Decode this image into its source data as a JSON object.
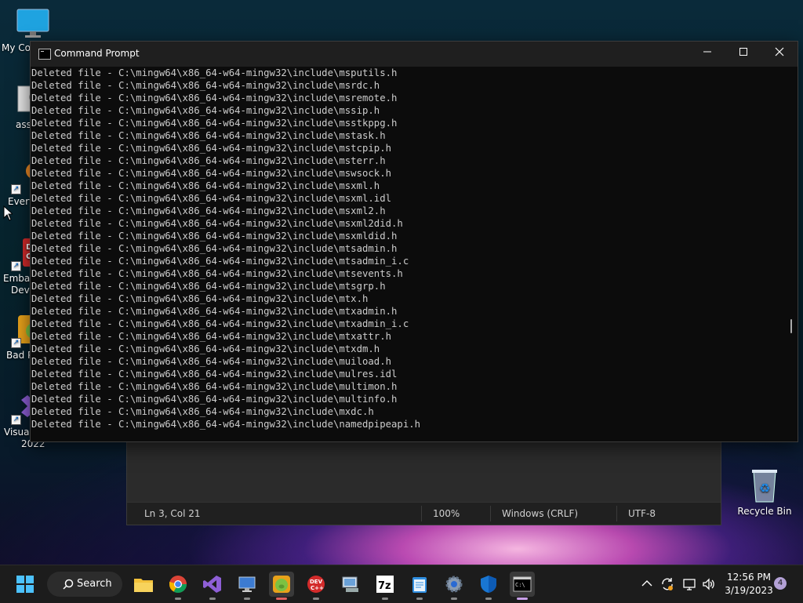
{
  "desktop": {
    "icons": [
      {
        "label": "My Co"
      },
      {
        "label": "ass"
      },
      {
        "label": "Every"
      },
      {
        "label": "Embar",
        "label2": "Dev-"
      },
      {
        "label": "Bad P"
      },
      {
        "label": "Visual",
        "label2": "2022"
      }
    ],
    "recycle_bin": "Recycle Bin"
  },
  "notepad": {
    "status": {
      "position": "Ln 3, Col 21",
      "zoom": "100%",
      "line_ending": "Windows (CRLF)",
      "encoding": "UTF-8"
    }
  },
  "cmd": {
    "title": "Command Prompt",
    "lines": [
      "Deleted file - C:\\mingw64\\x86_64-w64-mingw32\\include\\msputils.h",
      "Deleted file - C:\\mingw64\\x86_64-w64-mingw32\\include\\msrdc.h",
      "Deleted file - C:\\mingw64\\x86_64-w64-mingw32\\include\\msremote.h",
      "Deleted file - C:\\mingw64\\x86_64-w64-mingw32\\include\\mssip.h",
      "Deleted file - C:\\mingw64\\x86_64-w64-mingw32\\include\\msstkppg.h",
      "Deleted file - C:\\mingw64\\x86_64-w64-mingw32\\include\\mstask.h",
      "Deleted file - C:\\mingw64\\x86_64-w64-mingw32\\include\\mstcpip.h",
      "Deleted file - C:\\mingw64\\x86_64-w64-mingw32\\include\\msterr.h",
      "Deleted file - C:\\mingw64\\x86_64-w64-mingw32\\include\\mswsock.h",
      "Deleted file - C:\\mingw64\\x86_64-w64-mingw32\\include\\msxml.h",
      "Deleted file - C:\\mingw64\\x86_64-w64-mingw32\\include\\msxml.idl",
      "Deleted file - C:\\mingw64\\x86_64-w64-mingw32\\include\\msxml2.h",
      "Deleted file - C:\\mingw64\\x86_64-w64-mingw32\\include\\msxml2did.h",
      "Deleted file - C:\\mingw64\\x86_64-w64-mingw32\\include\\msxmldid.h",
      "Deleted file - C:\\mingw64\\x86_64-w64-mingw32\\include\\mtsadmin.h",
      "Deleted file - C:\\mingw64\\x86_64-w64-mingw32\\include\\mtsadmin_i.c",
      "Deleted file - C:\\mingw64\\x86_64-w64-mingw32\\include\\mtsevents.h",
      "Deleted file - C:\\mingw64\\x86_64-w64-mingw32\\include\\mtsgrp.h",
      "Deleted file - C:\\mingw64\\x86_64-w64-mingw32\\include\\mtx.h",
      "Deleted file - C:\\mingw64\\x86_64-w64-mingw32\\include\\mtxadmin.h",
      "Deleted file - C:\\mingw64\\x86_64-w64-mingw32\\include\\mtxadmin_i.c",
      "Deleted file - C:\\mingw64\\x86_64-w64-mingw32\\include\\mtxattr.h",
      "Deleted file - C:\\mingw64\\x86_64-w64-mingw32\\include\\mtxdm.h",
      "Deleted file - C:\\mingw64\\x86_64-w64-mingw32\\include\\muiload.h",
      "Deleted file - C:\\mingw64\\x86_64-w64-mingw32\\include\\mulres.idl",
      "Deleted file - C:\\mingw64\\x86_64-w64-mingw32\\include\\multimon.h",
      "Deleted file - C:\\mingw64\\x86_64-w64-mingw32\\include\\multinfo.h",
      "Deleted file - C:\\mingw64\\x86_64-w64-mingw32\\include\\mxdc.h",
      "Deleted file - C:\\mingw64\\x86_64-w64-mingw32\\include\\namedpipeapi.h"
    ]
  },
  "taskbar": {
    "search_label": "Search",
    "apps": [
      "start-icon",
      "file-explorer-icon",
      "chrome-icon",
      "visual-studio-icon",
      "remote-desktop-icon",
      "bad-piggies-icon",
      "dev-cpp-icon",
      "network-icon",
      "7zip-icon",
      "notepad-icon",
      "settings-icon",
      "defender-icon",
      "terminal-icon"
    ],
    "time": "12:56 PM",
    "date": "3/19/2023",
    "notification_count": "4"
  },
  "colors": {
    "accent": "#c8a0e8",
    "console_bg": "#0c0c0c",
    "console_fg": "#cccccc",
    "titlebar": "#1f1f1f"
  }
}
